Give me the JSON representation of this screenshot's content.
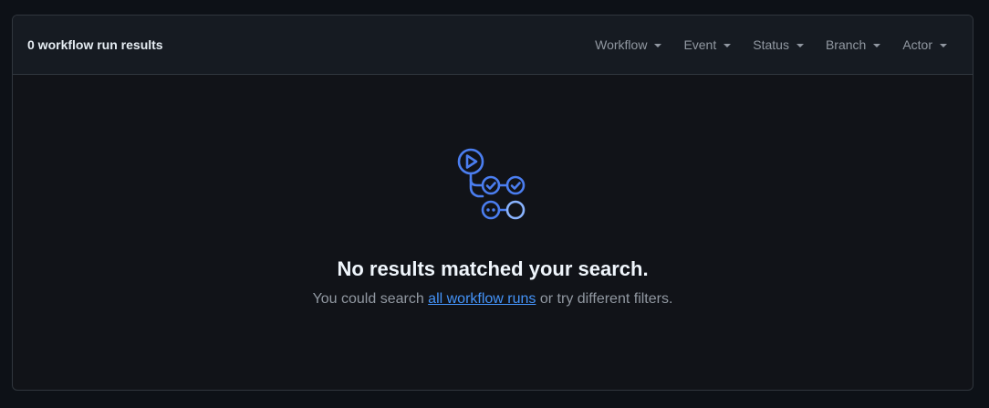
{
  "header": {
    "results_count": "0 workflow run results",
    "filters": [
      {
        "label": "Workflow"
      },
      {
        "label": "Event"
      },
      {
        "label": "Status"
      },
      {
        "label": "Branch"
      },
      {
        "label": "Actor"
      }
    ]
  },
  "blankslate": {
    "icon": "workflow-icon",
    "title": "No results matched your search.",
    "text_before": "You could search ",
    "link_text": "all workflow runs",
    "text_after": " or try different filters."
  },
  "colors": {
    "background": "#0d1117",
    "header_background": "#161b22",
    "border": "#30363d",
    "accent": "#4493f8",
    "icon": "#4b7ef0"
  }
}
